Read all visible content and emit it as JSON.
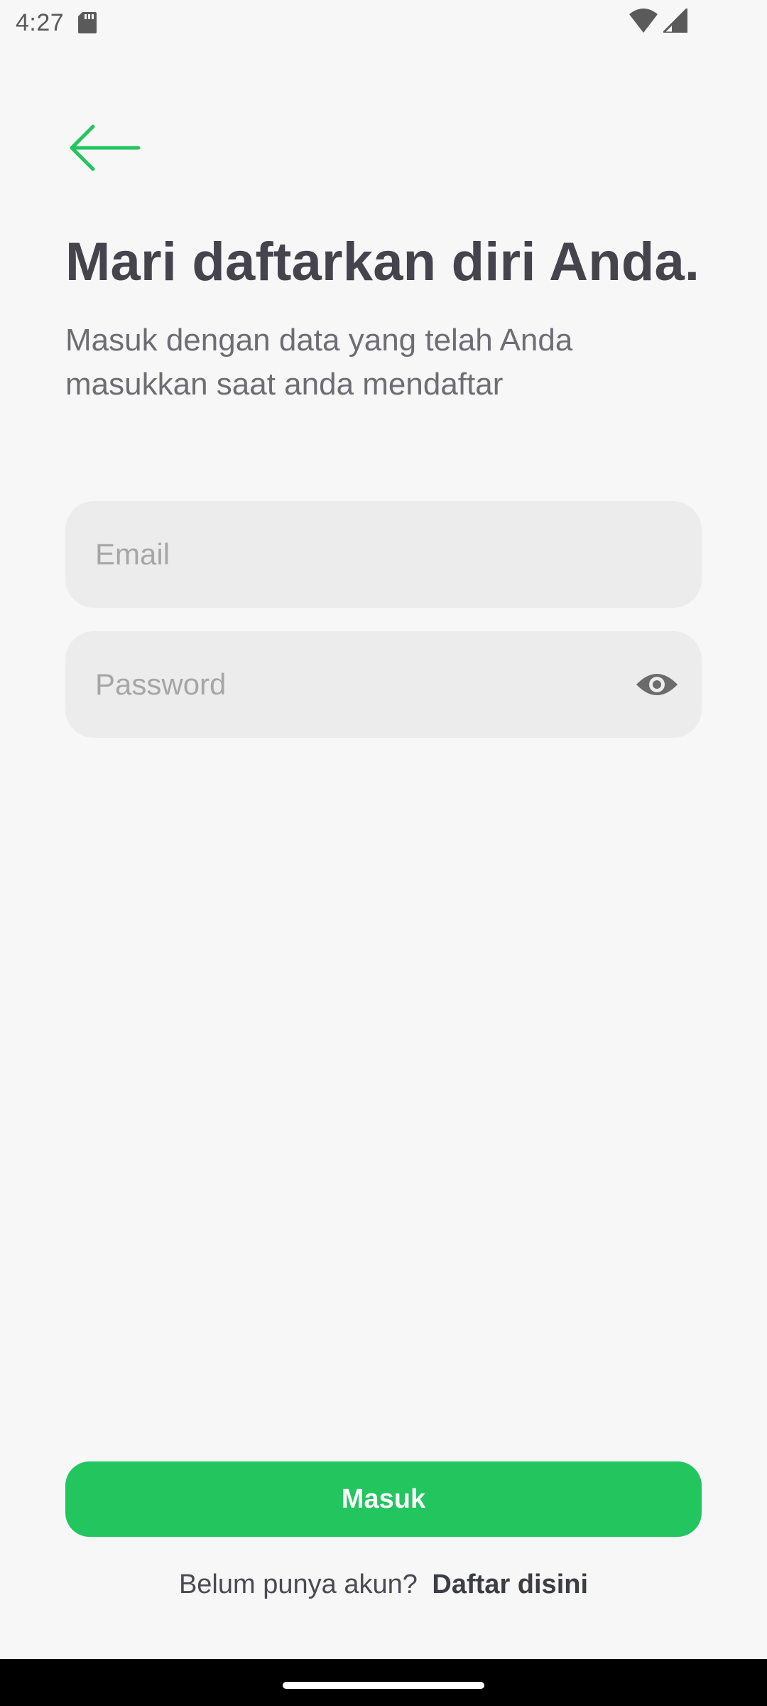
{
  "status_bar": {
    "time": "4:27",
    "icons": [
      "sd-card-icon",
      "wifi-icon",
      "signal-icon"
    ]
  },
  "colors": {
    "accent": "#22c55e",
    "background": "#f7f7f7",
    "input_background": "#ececec",
    "title_text": "#45444c"
  },
  "header": {
    "back_icon": "arrow-left-icon",
    "title": "Mari daftarkan diri Anda.",
    "subtitle": "Masuk dengan data yang telah Anda masukkan saat anda mendaftar"
  },
  "form": {
    "email": {
      "value": "",
      "placeholder": "Email"
    },
    "password": {
      "value": "",
      "placeholder": "Password",
      "toggle_icon": "eye-icon"
    },
    "submit_label": "Masuk"
  },
  "footer": {
    "prompt": "Belum punya akun?",
    "link": "Daftar disini"
  }
}
